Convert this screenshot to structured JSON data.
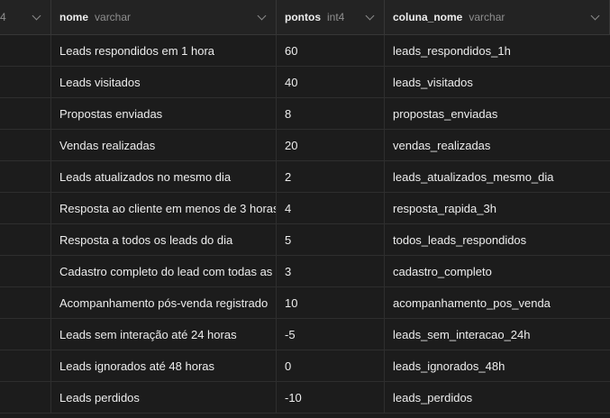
{
  "columns": [
    {
      "type": "4"
    },
    {
      "name": "nome",
      "type": "varchar"
    },
    {
      "name": "pontos",
      "type": "int4"
    },
    {
      "name": "coluna_nome",
      "type": "varchar"
    }
  ],
  "rows": [
    {
      "nome": "Leads respondidos em 1 hora",
      "pontos": "60",
      "coluna_nome": "leads_respondidos_1h"
    },
    {
      "nome": "Leads visitados",
      "pontos": "40",
      "coluna_nome": "leads_visitados"
    },
    {
      "nome": "Propostas enviadas",
      "pontos": "8",
      "coluna_nome": "propostas_enviadas"
    },
    {
      "nome": "Vendas realizadas",
      "pontos": "20",
      "coluna_nome": "vendas_realizadas"
    },
    {
      "nome": "Leads atualizados no mesmo dia",
      "pontos": "2",
      "coluna_nome": "leads_atualizados_mesmo_dia"
    },
    {
      "nome": "Resposta ao cliente em menos de 3 horas",
      "pontos": "4",
      "coluna_nome": "resposta_rapida_3h"
    },
    {
      "nome": "Resposta a todos os leads do dia",
      "pontos": "5",
      "coluna_nome": "todos_leads_respondidos"
    },
    {
      "nome": "Cadastro completo do lead com todas as",
      "pontos": "3",
      "coluna_nome": "cadastro_completo"
    },
    {
      "nome": "Acompanhamento pós-venda registrado",
      "pontos": "10",
      "coluna_nome": "acompanhamento_pos_venda"
    },
    {
      "nome": "Leads sem interação até 24 horas",
      "pontos": "-5",
      "coluna_nome": "leads_sem_interacao_24h"
    },
    {
      "nome": "Leads ignorados até 48 horas",
      "pontos": "0",
      "coluna_nome": "leads_ignorados_48h"
    },
    {
      "nome": "Leads perdidos",
      "pontos": "-10",
      "coluna_nome": "leads_perdidos"
    }
  ]
}
